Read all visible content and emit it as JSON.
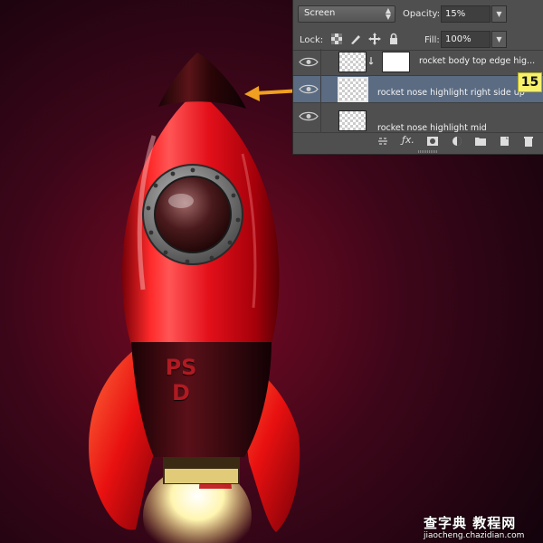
{
  "layers_panel": {
    "blend_mode": "Screen",
    "opacity_label": "Opacity:",
    "opacity_value": "15%",
    "lock_label": "Lock:",
    "fill_label": "Fill:",
    "fill_value": "100%",
    "layers": [
      {
        "name": "rocket body top edge hig...",
        "visible": true,
        "selected": false,
        "clipped": true
      },
      {
        "name": "rocket nose highlight right side up",
        "visible": true,
        "selected": true,
        "clipped": false
      },
      {
        "name": "rocket nose highlight mid",
        "visible": true,
        "selected": false,
        "clipped": false
      }
    ]
  },
  "step_badge": "15",
  "rocket": {
    "body_text": "PSD",
    "colors": {
      "body": "#e0101a",
      "nose": "#1a0306",
      "background": "#5a0a22",
      "flame": "#fff7c8"
    }
  },
  "watermark": {
    "title": "查字典 教程网",
    "url": "jiaocheng.chazidian.com"
  },
  "colors": {
    "panel_bg": "#4f4f4f",
    "selected_row": "#5a6b82",
    "badge_bg": "#f6f06a",
    "arrow": "#f0a020"
  }
}
